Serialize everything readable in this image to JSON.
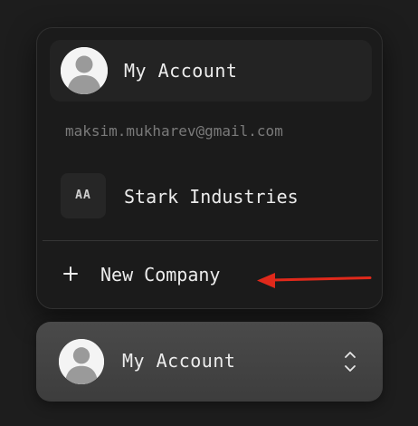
{
  "menu": {
    "account": {
      "label": "My Account",
      "avatar_icon": "user-avatar-icon"
    },
    "email": "maksim.mukharev@gmail.com",
    "company": {
      "initials": "AA",
      "name": "Stark Industries"
    },
    "new_company": {
      "label": "New Company",
      "icon": "plus-icon"
    }
  },
  "switcher": {
    "label": "My Account",
    "avatar_icon": "user-avatar-icon",
    "toggle_icon": "chevron-up-down-icon"
  },
  "annotation": {
    "arrow_color": "#e0291b",
    "points_to": "new-company-item"
  }
}
